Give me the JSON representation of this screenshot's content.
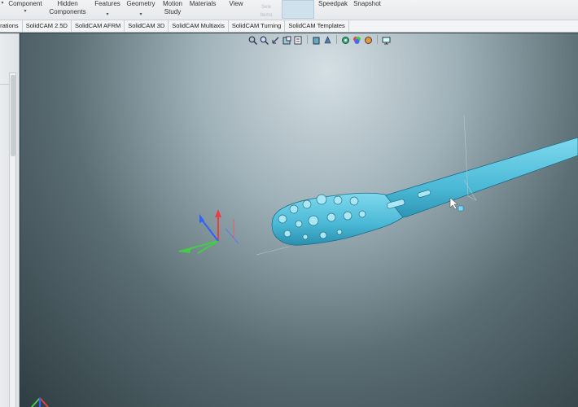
{
  "ribbon": {
    "component": "Component",
    "hidden_components": "Hidden Components",
    "features": "Features",
    "geometry": "Geometry",
    "motion_study": "Motion Study",
    "materials": "Materials",
    "view": "View",
    "dim_item": "Sele Items",
    "speedpak": "Speedpak",
    "snapshot": "Snapshot"
  },
  "tabs": [
    "erations",
    "SolidCAM 2.5D",
    "SolidCAM AFRM",
    "SolidCAM 3D",
    "SolidCAM Multiaxis",
    "SolidCAM Turning",
    "SolidCAM Templates"
  ],
  "hud_icons": [
    "zoom-to-fit-icon",
    "zoom-area-icon",
    "previous-view-icon",
    "section-view-icon",
    "dynamic-annotation-icon",
    "view-orientation-icon",
    "display-style-icon",
    "hide-show-icon",
    "edit-appearance-icon",
    "apply-scene-icon",
    "view-settings-icon"
  ],
  "colors": {
    "part": "#4fc3e0",
    "axis_x": "#e84040",
    "axis_y": "#44cc44",
    "axis_z": "#3060ff"
  }
}
